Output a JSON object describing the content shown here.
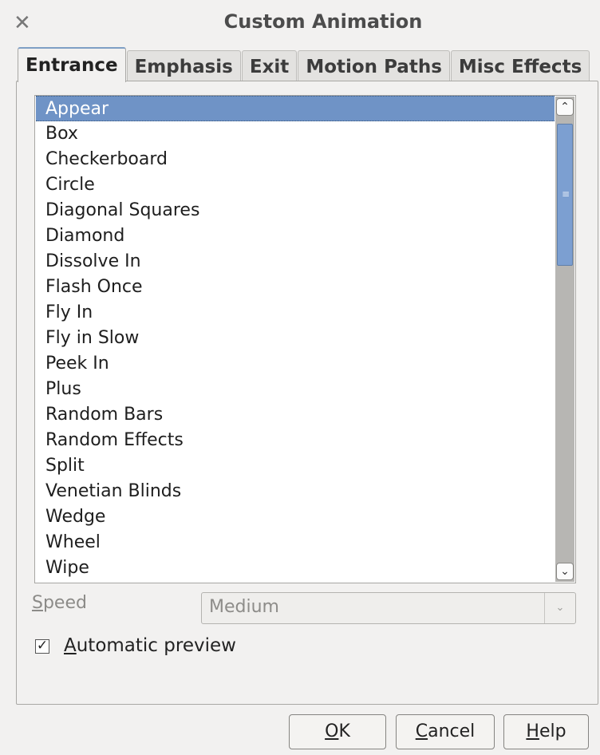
{
  "dialog": {
    "title": "Custom Animation",
    "close_icon": "close-icon"
  },
  "tabs": [
    {
      "label": "Entrance",
      "active": true
    },
    {
      "label": "Emphasis"
    },
    {
      "label": "Exit"
    },
    {
      "label": "Motion Paths"
    },
    {
      "label": "Misc Effects"
    }
  ],
  "effects": {
    "selected": "Appear",
    "items": [
      "Appear",
      "Box",
      "Checkerboard",
      "Circle",
      "Diagonal Squares",
      "Diamond",
      "Dissolve In",
      "Flash Once",
      "Fly In",
      "Fly in Slow",
      "Peek In",
      "Plus",
      "Random Bars",
      "Random Effects",
      "Split",
      "Venetian Blinds",
      "Wedge",
      "Wheel",
      "Wipe"
    ]
  },
  "speed": {
    "label_first": "S",
    "label_rest": "peed",
    "value": "Medium"
  },
  "preview": {
    "label_first": "A",
    "label_rest": "utomatic preview",
    "checked": true
  },
  "buttons": {
    "ok_first": "O",
    "ok_rest": "K",
    "cancel_first": "C",
    "cancel_rest": "ancel",
    "help_first": "H",
    "help_rest": "elp"
  },
  "colors": {
    "selection": "#6f93c6",
    "scroll_thumb": "#7c9fd1"
  }
}
